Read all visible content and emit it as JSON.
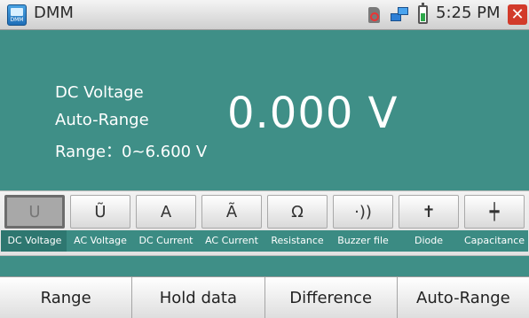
{
  "titlebar": {
    "app_icon_text": "DMM",
    "title": "DMM",
    "time": "5:25 PM",
    "close_glyph": "✕",
    "status_icons": [
      "sd-card-removed-icon",
      "network-icon",
      "battery-icon"
    ]
  },
  "readout": {
    "mode": "DC Voltage",
    "range_mode": "Auto-Range",
    "range": "Range：0~6.600 V",
    "value": "0.000 V"
  },
  "functions": [
    {
      "glyph": "U",
      "label": "DC Voltage",
      "active": true
    },
    {
      "glyph": "Ũ",
      "label": "AC Voltage",
      "active": false
    },
    {
      "glyph": "A",
      "label": "DC Current",
      "active": false
    },
    {
      "glyph": "Ã",
      "label": "AC Current",
      "active": false
    },
    {
      "glyph": "Ω",
      "label": "Resistance",
      "active": false
    },
    {
      "glyph": "·))",
      "label": "Buzzer file",
      "active": false
    },
    {
      "glyph": "✝",
      "label": "Diode",
      "active": false
    },
    {
      "glyph": "┿",
      "label": "Capacitance",
      "active": false
    }
  ],
  "softkeys": [
    "Range",
    "Hold data",
    "Difference",
    "Auto-Range"
  ],
  "colors": {
    "background": "#3f8f87",
    "label_strip": "#3b8b83",
    "close": "#d23a2a"
  }
}
